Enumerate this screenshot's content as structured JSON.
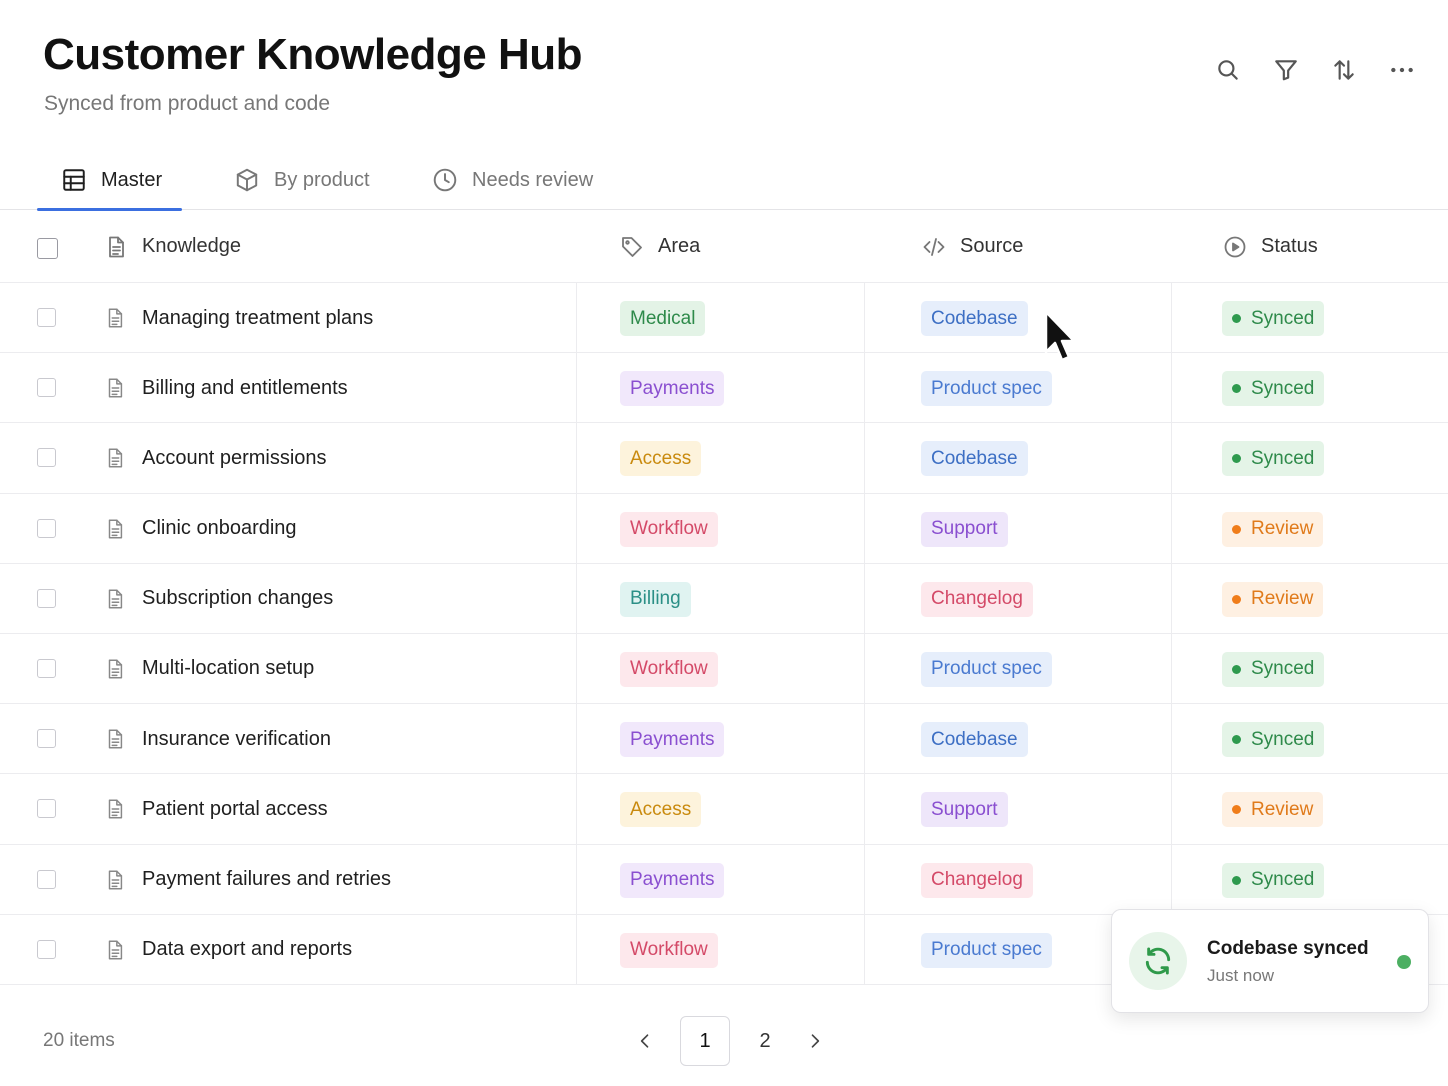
{
  "header": {
    "title": "Customer Knowledge Hub",
    "subtitle": "Synced from product and code",
    "toolbar": [
      "search-icon",
      "filter-icon",
      "sort-icon",
      "more-icon"
    ]
  },
  "tabs": [
    {
      "label": "Master",
      "icon": "table-icon",
      "active": true
    },
    {
      "label": "By product",
      "icon": "cube-icon",
      "active": false
    },
    {
      "label": "Needs review",
      "icon": "clock-icon",
      "active": false
    }
  ],
  "table": {
    "columns": [
      {
        "label": "Knowledge",
        "icon": "document-icon"
      },
      {
        "label": "Area",
        "icon": "tag-icon"
      },
      {
        "label": "Source",
        "icon": "code-icon"
      },
      {
        "label": "Status",
        "icon": "status-icon"
      }
    ],
    "rows": [
      {
        "name": "Managing treatment plans",
        "area": "Medical",
        "source": "Codebase",
        "status": "Synced"
      },
      {
        "name": "Billing and entitlements",
        "area": "Payments",
        "source": "Product spec",
        "status": "Synced"
      },
      {
        "name": "Account permissions",
        "area": "Access",
        "source": "Codebase",
        "status": "Synced"
      },
      {
        "name": "Clinic onboarding",
        "area": "Workflow",
        "source": "Support",
        "status": "Review"
      },
      {
        "name": "Subscription changes",
        "area": "Billing",
        "source": "Changelog",
        "status": "Review"
      },
      {
        "name": "Multi-location setup",
        "area": "Workflow",
        "source": "Product spec",
        "status": "Synced"
      },
      {
        "name": "Insurance verification",
        "area": "Payments",
        "source": "Codebase",
        "status": "Synced"
      },
      {
        "name": "Patient portal access",
        "area": "Access",
        "source": "Support",
        "status": "Review"
      },
      {
        "name": "Payment failures and retries",
        "area": "Payments",
        "source": "Changelog",
        "status": "Synced"
      },
      {
        "name": "Data export and reports",
        "area": "Workflow",
        "source": "Product spec",
        "status": ""
      }
    ]
  },
  "tag_colors": {
    "Medical": {
      "bg": "#e3f3e6",
      "fg": "#2e8a4a"
    },
    "Payments": {
      "bg": "#f1e8fb",
      "fg": "#8a4fd0"
    },
    "Access": {
      "bg": "#fdf3dc",
      "fg": "#c98a0e"
    },
    "Workflow": {
      "bg": "#fde8ec",
      "fg": "#d44a68"
    },
    "Billing": {
      "bg": "#e0f3f1",
      "fg": "#2a8f86"
    },
    "Codebase": {
      "bg": "#e6eefb",
      "fg": "#3d6fc4"
    },
    "Product spec": {
      "bg": "#e6eefb",
      "fg": "#4a7ad0"
    },
    "Support": {
      "bg": "#eee6fa",
      "fg": "#8a4fd0"
    },
    "Changelog": {
      "bg": "#fde8ec",
      "fg": "#d44a68"
    },
    "Synced": {
      "bg": "#e4f4e7",
      "fg": "#2e8a4a",
      "dot": "#2e9a4e"
    },
    "Review": {
      "bg": "#fef0e2",
      "fg": "#e07a1a",
      "dot": "#f07d1a"
    }
  },
  "footer": {
    "count": "20 items",
    "pages": [
      "1",
      "2"
    ],
    "current_page": "1"
  },
  "toast": {
    "title": "Codebase synced",
    "subtitle": "Just now",
    "icon": "refresh-icon"
  }
}
